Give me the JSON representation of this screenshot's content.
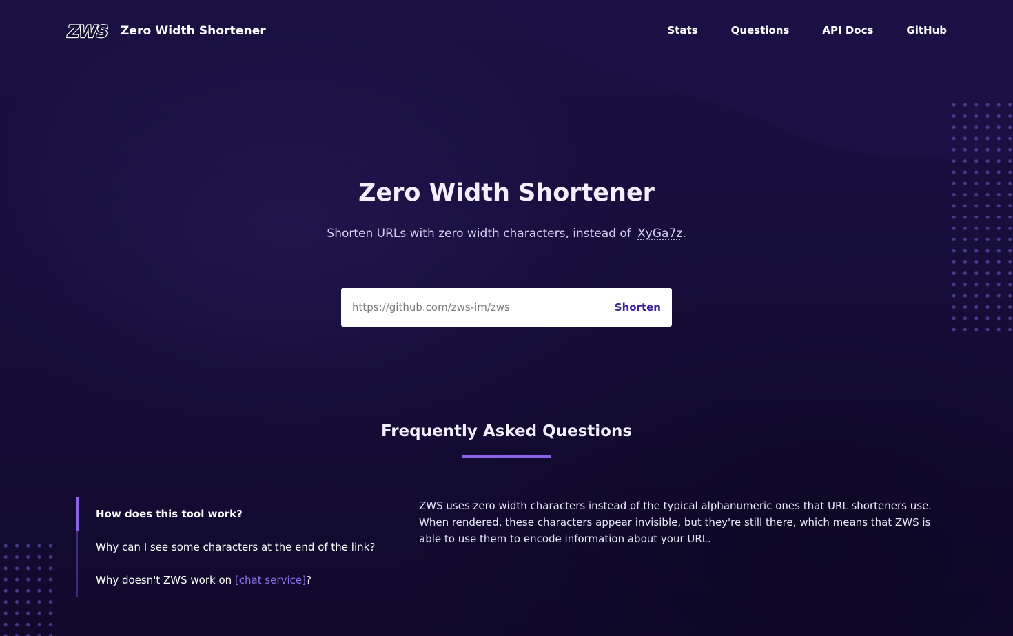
{
  "header": {
    "brand_name": "Zero Width Shortener",
    "logo_text": "ZWS",
    "nav": {
      "stats": "Stats",
      "questions": "Questions",
      "api_docs": "API Docs",
      "github": "GitHub"
    }
  },
  "hero": {
    "title": "Zero Width Shortener",
    "subtitle_prefix": "Shorten URLs with zero width characters, instead of",
    "subtitle_example": "XyGa7z",
    "subtitle_suffix": "."
  },
  "form": {
    "url_placeholder": "https://github.com/zws-im/zws",
    "url_value": "",
    "shorten_label": "Shorten"
  },
  "faq": {
    "title": "Frequently Asked Questions",
    "questions": [
      {
        "text": "How does this tool work?",
        "active": true
      },
      {
        "text": "Why can I see some characters at the end of the link?",
        "active": false
      },
      {
        "prefix": "Why doesn't ZWS work on ",
        "link": "[chat service]",
        "suffix": "?",
        "active": false
      }
    ],
    "answer": "ZWS uses zero width characters instead of the typical alphanumeric ones that URL shorteners use. When rendered, these characters appear invisible, but they're still there, which means that ZWS is able to use them to encode information about your URL."
  },
  "colors": {
    "background": "#140c33",
    "accent": "#8a63e8",
    "link": "#8b6ff0",
    "button_text": "#3b2296"
  },
  "icons": {
    "logo": "zws-logo-icon"
  }
}
